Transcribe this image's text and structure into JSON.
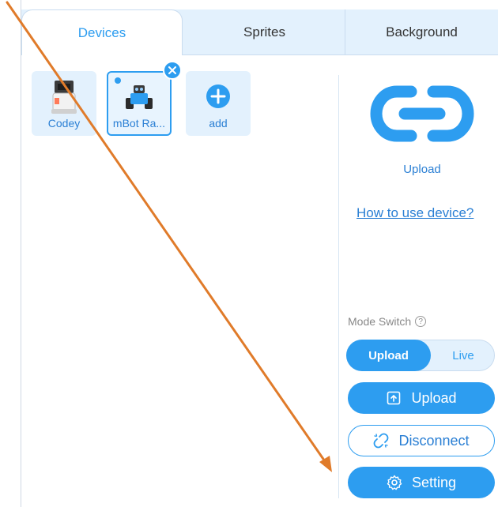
{
  "tabs": [
    {
      "label": "Devices",
      "active": true
    },
    {
      "label": "Sprites",
      "active": false
    },
    {
      "label": "Background",
      "active": false
    }
  ],
  "devices": [
    {
      "label": "Codey",
      "icon": "codey-robot-icon"
    },
    {
      "label": "mBot Ra...",
      "icon": "mbot-ranger-icon",
      "selected": true
    },
    {
      "label": "add",
      "icon": "add-icon"
    }
  ],
  "connection": {
    "caption": "Upload",
    "help_link": "How to use device?",
    "mode_switch_label": "Mode Switch",
    "mode_options": [
      "Upload",
      "Live"
    ],
    "active_mode": "Upload",
    "upload_button": "Upload",
    "disconnect_button": "Disconnect",
    "setting_button": "Setting"
  },
  "colors": {
    "accent": "#2d9df0",
    "annotation_arrow": "#e07b2a"
  }
}
